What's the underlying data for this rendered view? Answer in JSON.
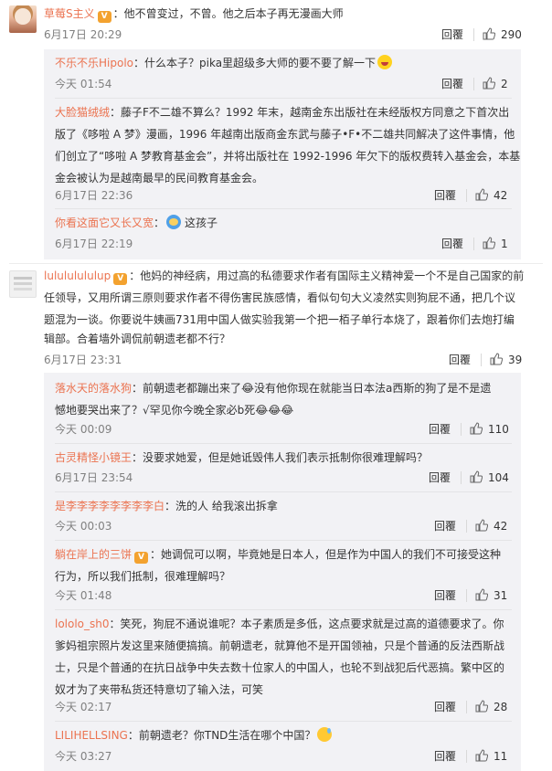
{
  "icons": {
    "like": "thumbs-up-icon",
    "badge": "vip-badge-icon"
  },
  "colors": {
    "username": "#eb7350",
    "meta": "#808080",
    "reply_bg": "#f2f2f5"
  },
  "actions": {
    "reply": "回覆"
  },
  "comments": [
    {
      "user": "草莓S主义",
      "text": "：他不曾变过，不曾。他之后本子再无漫画大师",
      "time": "6月17日 20:29",
      "likes": "290",
      "replies": [
        {
          "user": "不乐不乐Hipolo",
          "lines": [
            "：什么本子？pika里超级多大师的要不要了解一下"
          ],
          "time": "今天 01:54",
          "likes": "2"
        },
        {
          "user": "大脸猫绒绒",
          "lines": [
            "：藤子F不二雄不算么？1992 年末，越南金东出版社在未经版权方同意之下首次出",
            "版了《哆啦 A 梦》漫画，1996 年越南出版商金东武与藤子•F•不二雄共同解决了这件事情，他",
            "们创立了“哆啦 A 梦教育基金会”，并将出版社在 1992-1996 年欠下的版权费转入基金会，本基",
            "金会被认为是越南最早的民间教育基金会。"
          ],
          "time": "6月17日 22:36",
          "likes": "42"
        },
        {
          "user": "你看这面它又长又宽",
          "lines": [
            "：",
            "这孩子"
          ],
          "time": "6月17日 22:19",
          "likes": "1"
        }
      ]
    },
    {
      "user": "lulululululup",
      "lines": [
        "：他妈的神经病，用过高的私德要求作者有国际主义精神爱一个不是自己国家的前",
        "任领导，又用所谓三原则要求作者不得伤害民族感情，看似句句大义凌然实则狗屁不通，把几个议",
        "题混为一谈。你要说牛姨画731用中国人做实验我第一个把一栢子单行本烧了，跟着你们去炮打编",
        "辑部。合着墙外调侃前朝遗老都不行？"
      ],
      "time": "6月17日 23:31",
      "likes": "39",
      "replies": [
        {
          "user": "落水天的落水狗",
          "lines": [
            "：前朝遗老都蹦出来了😂没有他你现在就能当日本法a西斯的狗了是不是遗",
            "憾地要哭出来了？√罕见你今晚全家必b死😂😂😂"
          ],
          "time": "今天 00:09",
          "likes": "110"
        },
        {
          "user": "古灵精怪小镜王",
          "lines": [
            "：没要求她爱，但是她诋毁伟人我们表示抵制你很难理解吗？"
          ],
          "time": "6月17日 23:54",
          "likes": "104"
        },
        {
          "user": "是李李李李李李李李白",
          "lines": [
            "：洗的人 给我滚出拆拿"
          ],
          "time": "今天 00:03",
          "likes": "42"
        },
        {
          "user": "躺在岸上的三饼",
          "lines": [
            "：她调侃可以啊，毕竟她是日本人，但是作为中国人的我们不可接受这种",
            "行为，所以我们抵制，很难理解吗？"
          ],
          "time": "今天 01:48",
          "likes": "31"
        },
        {
          "user": "lololo_sh0",
          "lines": [
            "：笑死，狗屁不通说谁呢？本子素质是多低，这点要求就是过高的道德要求了。你",
            "爹妈祖宗照片发这里来随便搞搞。前朝遗老，就算他不是开国领袖，只是个普通的反法西斯战",
            "士，只是个普通的在抗日战争中失去数十位家人的中国人，也轮不到战犯后代恶搞。繁中区的",
            "奴才为了夹带私货还特意切了输入法，可笑"
          ],
          "time": "今天 02:17",
          "likes": "28"
        },
        {
          "user": "LILIHELLSING",
          "lines": [
            "：前朝遗老？你TND生活在哪个中国？"
          ],
          "time": "今天 03:27",
          "likes": "11"
        }
      ]
    }
  ]
}
